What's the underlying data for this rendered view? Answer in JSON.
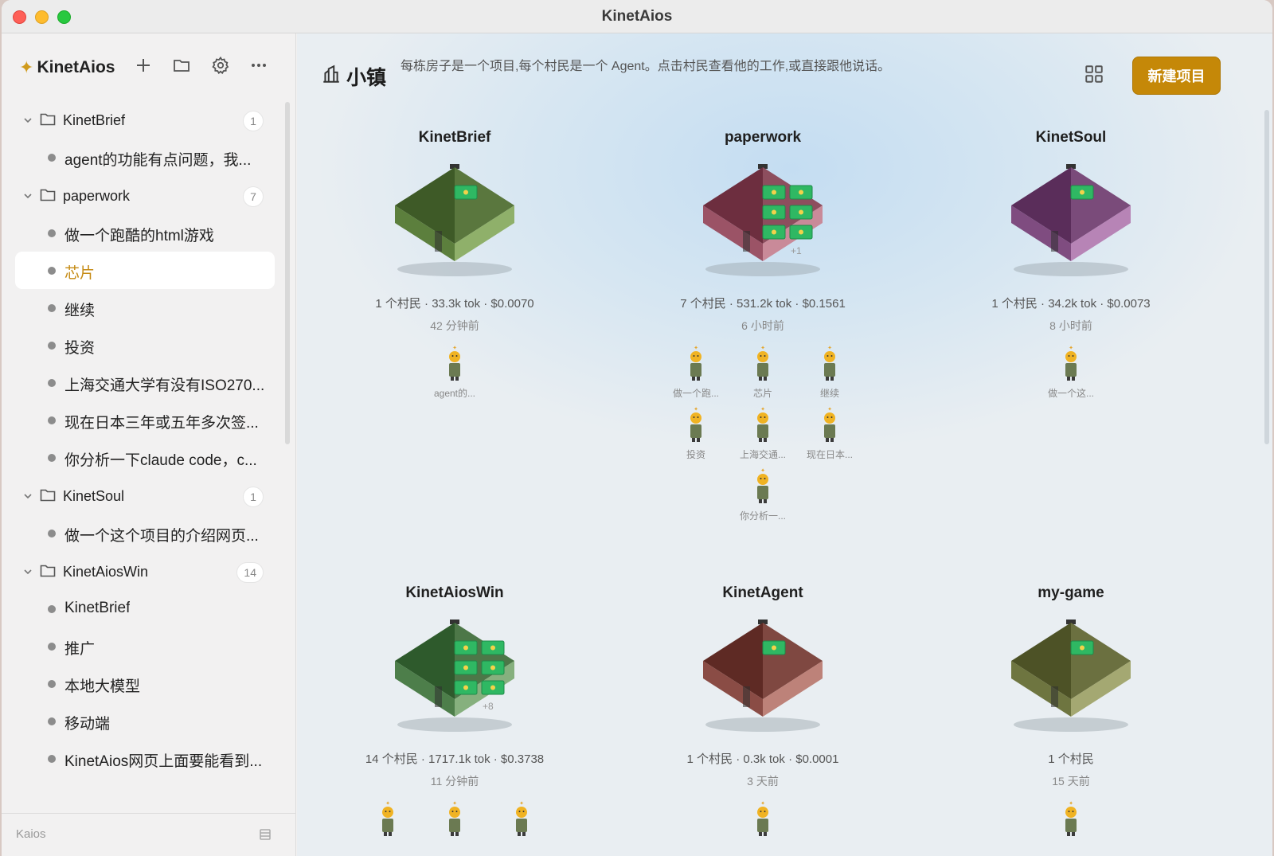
{
  "window": {
    "title": "KinetAios"
  },
  "sidebar": {
    "brand": "KinetAios",
    "groups": [
      {
        "name": "KinetBrief",
        "count": "1",
        "items": [
          "agent的功能有点问题，我..."
        ]
      },
      {
        "name": "paperwork",
        "count": "7",
        "items": [
          "做一个跑酷的html游戏",
          "芯片",
          "继续",
          "投资",
          "上海交通大学有没有ISO270...",
          "现在日本三年或五年多次签...",
          "你分析一下claude code，c..."
        ]
      },
      {
        "name": "KinetSoul",
        "count": "1",
        "items": [
          "做一个这个项目的介绍网页..."
        ]
      },
      {
        "name": "KinetAiosWin",
        "count": "14",
        "items": [
          "KinetBrief",
          "推广",
          "本地大模型",
          "移动端",
          "KinetAios网页上面要能看到..."
        ]
      }
    ],
    "active_item": "芯片",
    "footer": "Kaios"
  },
  "header": {
    "title": "小镇",
    "description": "每栋房子是一个项目,每个村民是一个 Agent。点击村民查看他的工作,或直接跟他说话。",
    "new_button": "新建项目"
  },
  "projects": [
    {
      "name": "KinetBrief",
      "stats": "1 个村民 · 33.3k tok · $0.0070",
      "time": "42 分钟前",
      "villagers": [
        "agent的..."
      ],
      "roof": "#3e5a27",
      "left": "#5c7f3d",
      "right": "#8fb06a",
      "door_letter": "K",
      "windows": 1,
      "extra": ""
    },
    {
      "name": "paperwork",
      "stats": "7 个村民 · 531.2k tok · $0.1561",
      "time": "6 小时前",
      "villagers": [
        "做一个跑...",
        "芯片",
        "继续",
        "投资",
        "上海交通...",
        "现在日本...",
        "你分析一..."
      ],
      "roof": "#6d2e3f",
      "left": "#9b5366",
      "right": "#c98a99",
      "door_letter": "P",
      "windows": 6,
      "extra": "+1"
    },
    {
      "name": "KinetSoul",
      "stats": "1 个村民 · 34.2k tok · $0.0073",
      "time": "8 小时前",
      "villagers": [
        "做一个这..."
      ],
      "roof": "#5a2d5a",
      "left": "#7f4c80",
      "right": "#b784b6",
      "door_letter": "K",
      "windows": 1,
      "extra": ""
    },
    {
      "name": "KinetAiosWin",
      "stats": "14 个村民 · 1717.1k tok · $0.3738",
      "time": "11 分钟前",
      "villagers": [
        "",
        "",
        ""
      ],
      "roof": "#2e5a2c",
      "left": "#4d7e4a",
      "right": "#86b07e",
      "door_letter": "K",
      "windows": 6,
      "extra": "+8"
    },
    {
      "name": "KinetAgent",
      "stats": "1 个村民 · 0.3k tok · $0.0001",
      "time": "3 天前",
      "villagers": [
        ""
      ],
      "roof": "#5e2a24",
      "left": "#8a4c45",
      "right": "#bd8279",
      "door_letter": "K",
      "windows": 1,
      "extra": ""
    },
    {
      "name": "my-game",
      "stats": "1 个村民",
      "time": "15 天前",
      "villagers": [
        ""
      ],
      "roof": "#4d5226",
      "left": "#6e7540",
      "right": "#a4a872",
      "door_letter": "M",
      "windows": 1,
      "extra": ""
    }
  ],
  "colors": {
    "accent": "#c58808",
    "active_text": "#c58a13",
    "window_green": "#2fb863"
  }
}
